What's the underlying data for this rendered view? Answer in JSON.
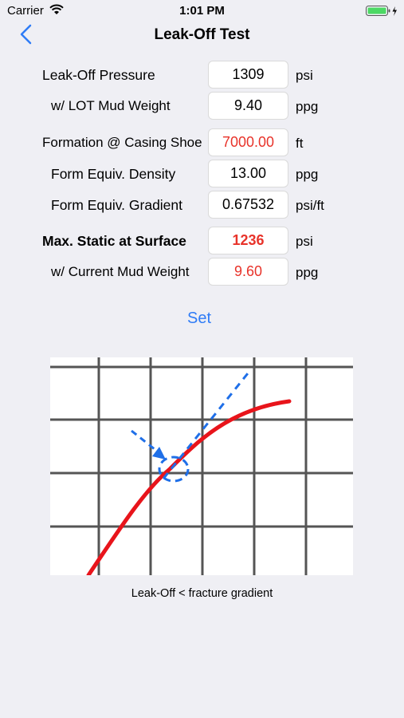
{
  "status": {
    "carrier": "Carrier",
    "time": "1:01 PM"
  },
  "nav": {
    "title": "Leak-Off Test"
  },
  "rows": [
    {
      "label": "Leak-Off Pressure",
      "value": "1309",
      "unit": "psi"
    },
    {
      "label": "w/ LOT Mud Weight",
      "value": "9.40",
      "unit": "ppg"
    },
    {
      "label": "Formation @ Casing Shoe",
      "value": "7000.00",
      "unit": "ft"
    },
    {
      "label": "Form Equiv. Density",
      "value": "13.00",
      "unit": "ppg"
    },
    {
      "label": "Form Equiv. Gradient",
      "value": "0.67532",
      "unit": "psi/ft"
    },
    {
      "label": "Max. Static at Surface",
      "value": "1236",
      "unit": "psi"
    },
    {
      "label": "w/ Current Mud Weight",
      "value": "9.60",
      "unit": "ppg"
    }
  ],
  "set_label": "Set",
  "diagram": {
    "caption": "Leak-Off < fracture gradient"
  },
  "colors": {
    "accent": "#2f7cf6",
    "result_red": "#e8332a",
    "curve_red": "#e8141b",
    "dash_blue": "#1f6fe8"
  }
}
